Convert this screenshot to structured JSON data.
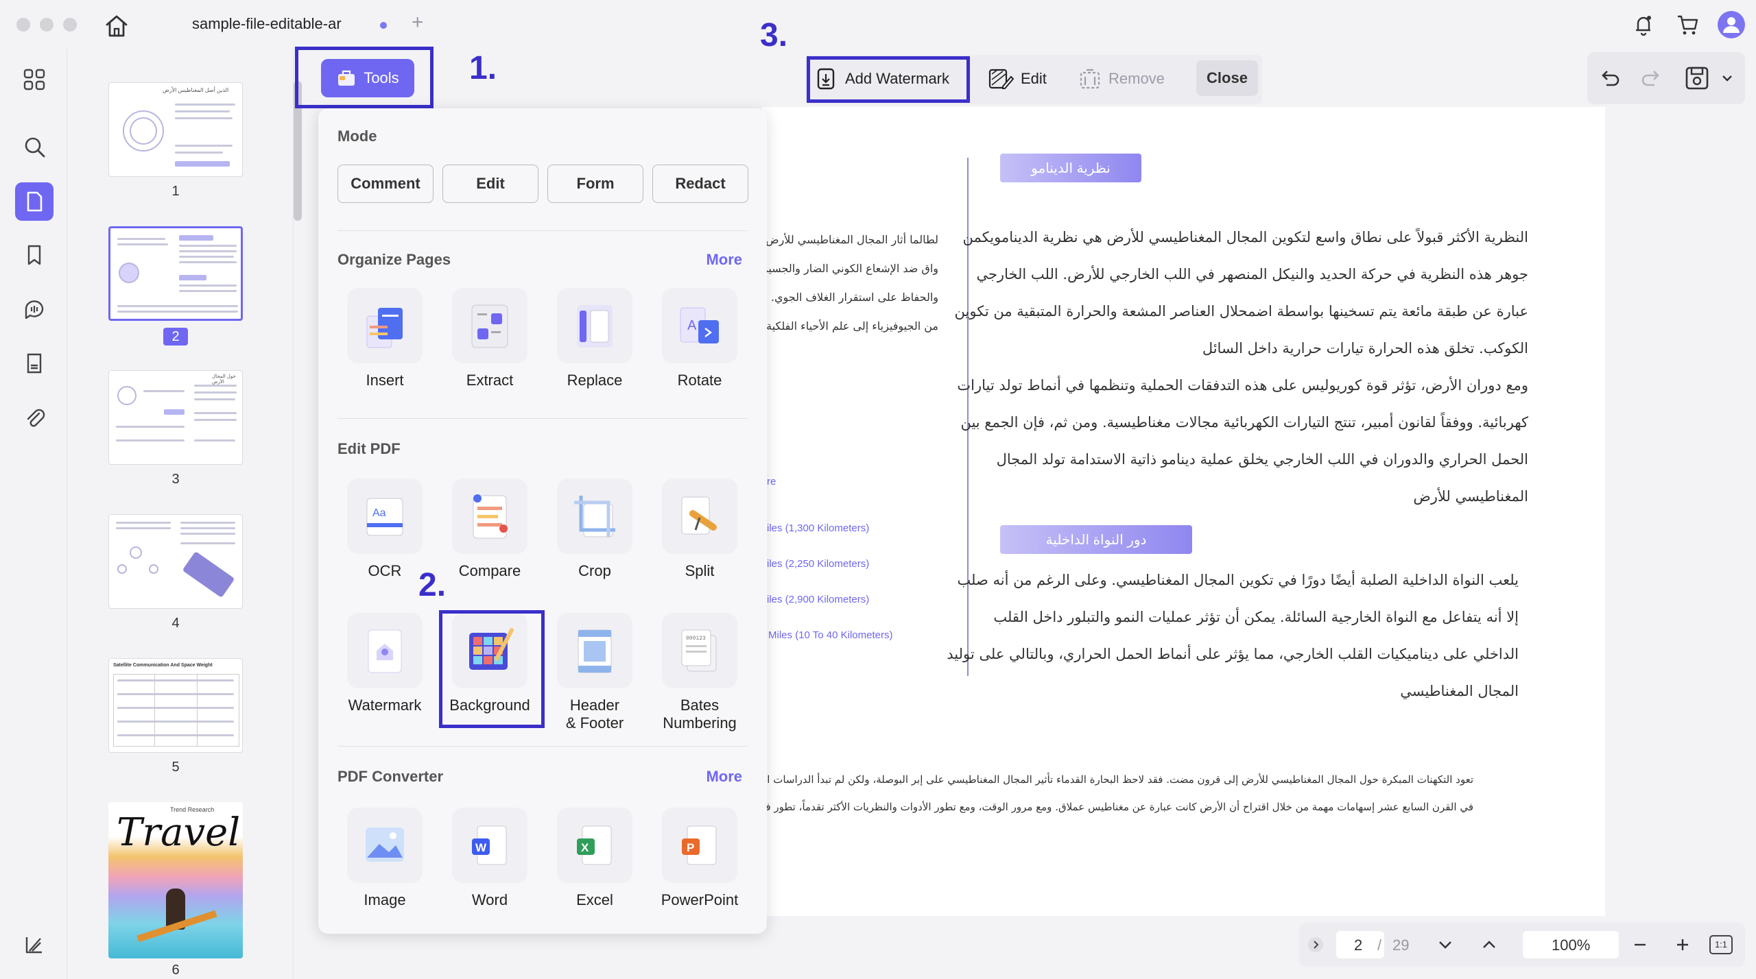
{
  "window": {
    "tab_title": "sample-file-editable-ar",
    "tab_add": "+"
  },
  "toolbar": {
    "tools_label": "Tools",
    "add_watermark_label": "Add Watermark",
    "edit_label": "Edit",
    "remove_label": "Remove",
    "close_label": "Close"
  },
  "steps": {
    "one": "1.",
    "two": "2.",
    "three": "3."
  },
  "thumbnails": [
    {
      "num": "1"
    },
    {
      "num": "2"
    },
    {
      "num": "3"
    },
    {
      "num": "4"
    },
    {
      "num": "5"
    },
    {
      "num": "6"
    }
  ],
  "thumb_text": {
    "travel_title": "Travel",
    "thumb1_title": "الذين أصل المغناطيس الأرض",
    "thumb3_title": "حول المجال الأرض",
    "thumb5_title": "Satellite Communication And Space Weight",
    "travel_sub": "Trend Research"
  },
  "panel": {
    "mode_title": "Mode",
    "modes": [
      "Comment",
      "Edit",
      "Form",
      "Redact"
    ],
    "organize_title": "Organize Pages",
    "organize_more": "More",
    "organize_tools": [
      "Insert",
      "Extract",
      "Replace",
      "Rotate"
    ],
    "edit_title": "Edit PDF",
    "edit_tools_row1": [
      "OCR",
      "Compare",
      "Crop",
      "Split"
    ],
    "edit_tools_row2": [
      "Watermark",
      "Background",
      "Header\n& Footer",
      "Bates\nNumbering"
    ],
    "converter_title": "PDF Converter",
    "converter_more": "More",
    "converter_tools": [
      "Image",
      "Word",
      "Excel",
      "PowerPoint"
    ]
  },
  "document": {
    "header1": "نظرية الدينامو",
    "para1": [
      "النظرية الأكثر قبولاً على نطاق واسع لتكوين المجال المغناطيسي للأرض هي نظرية الدينامويكمن",
      "جوهر هذه النظرية في حركة الحديد والنيكل المنصهر في اللب الخارجي للأرض. اللب الخارجي",
      "عبارة عن طبقة مائعة يتم تسخينها بواسطة اضمحلال العناصر المشعة والحرارة المتبقية من تكوين",
      "الكوكب. تخلق هذه الحرارة تيارات حرارية داخل السائل",
      "ومع دوران الأرض، تؤثر قوة كوريوليس على هذه التدفقات الحملية وتنظمها في أنماط تولد تيارات",
      "كهربائية. ووفقاً لقانون أمبير، تنتج التيارات الكهربائية مجالات مغناطيسية. ومن ثم، فإن الجمع بين",
      "الحمل الحراري والدوران في اللب الخارجي يخلق عملية دينامو ذاتية الاستدامة تولد المجال",
      "المغناطيسي للأرض"
    ],
    "header2": "دور النواة الداخلية",
    "para2": [
      "يلعب النواة الداخلية الصلبة أيضًا دورًا في تكوين المجال المغناطيسي. وعلى الرغم من أنه صلب",
      "إلا أنه يتفاعل مع النواة الخارجية السائلة. يمكن أن تؤثر عمليات النمو والتبلور داخل القلب",
      "الداخلي على ديناميكيات القلب الخارجي، مما يؤثر على أنماط الحمل الحراري، وبالتالي على توليد",
      "المجال المغناطيسي"
    ],
    "left_col": [
      "لطالما أثار المجال المغناطيسي للأرض",
      "واق ضد الإشعاع الكوني الضار والجسيم",
      "والحفاظ على استقرار الغلاف الجوي. وب",
      "من الجيوفيزياء إلى علم الأحياء الفلكية"
    ],
    "left_col2": [
      "re",
      "iles (1,300 Kilometers)",
      "iles (2,250 Kilometers)",
      "iles (2,900 Kilometers)",
      "Miles (10 To 40 Kilometers)"
    ],
    "footer_lines": [
      "تعود التكهنات المبكرة حول المجال المغناطيسي للأرض إلى قرون مضت. فقد لاحظ البحارة القدماء تأثير المجال المغناطيسي على إبر البوصلة، ولكن لم تبدأ الدراسات الأكا",
      "في القرن السابع عشر إسهامات مهمة من خلال اقتراح أن الأرض كانت عبارة عن مغناطيس عملاق. ومع مرور الوقت، ومع تطور الأدوات والنظريات الأكثر تقدماً، تطور فهم"
    ]
  },
  "bottom_nav": {
    "page_current": "2",
    "page_sep": "/",
    "page_total": "29",
    "zoom": "100%",
    "fit_label": "1:1"
  },
  "colors": {
    "accent": "#6f67f1",
    "annotation": "#3b2fc9"
  }
}
